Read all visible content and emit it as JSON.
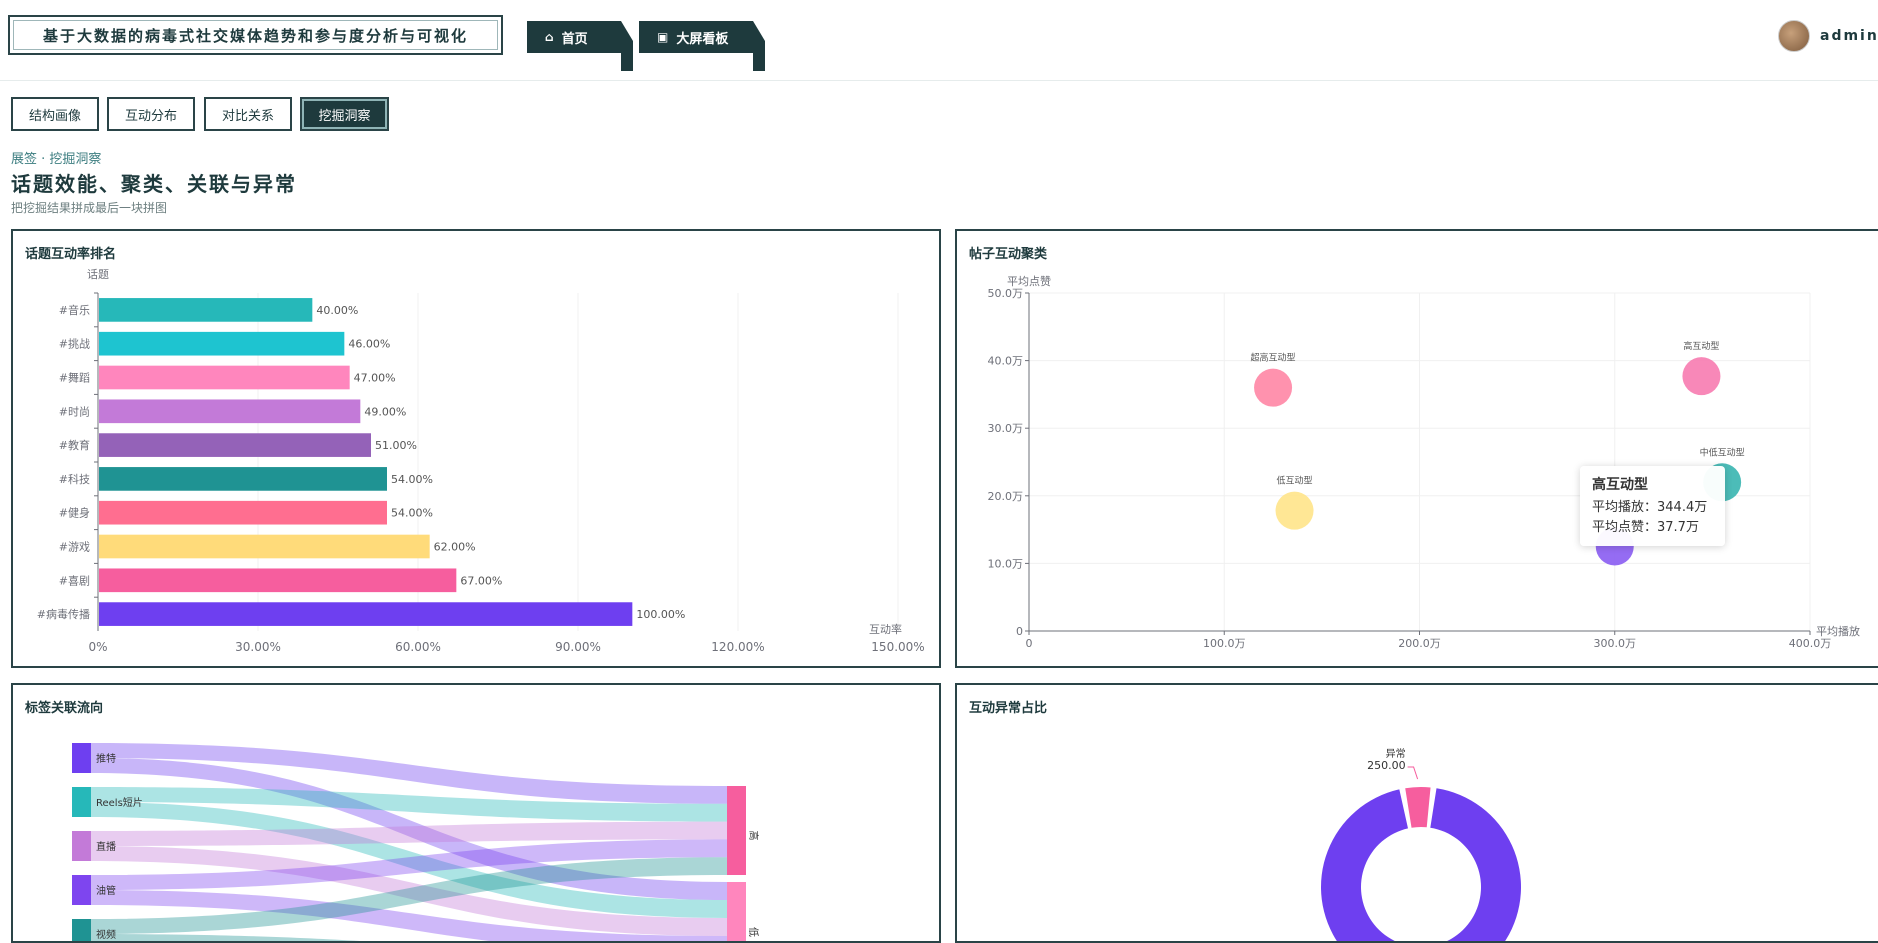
{
  "header": {
    "title": "基于大数据的病毒式社交媒体趋势和参与度分析与可视化",
    "nav": [
      {
        "label": "首页",
        "icon": "home-icon"
      },
      {
        "label": "大屏看板",
        "icon": "dashboard-icon"
      }
    ],
    "user": {
      "name": "admin"
    }
  },
  "subtabs": [
    {
      "label": "结构画像",
      "active": false
    },
    {
      "label": "互动分布",
      "active": false
    },
    {
      "label": "对比关系",
      "active": false
    },
    {
      "label": "挖掘洞察",
      "active": true
    }
  ],
  "page": {
    "breadcrumb": "展签 · 挖掘洞察",
    "title": "话题效能、聚类、关联与异常",
    "subtitle": "把挖掘结果拼成最后一块拼图"
  },
  "panels": {
    "bar": {
      "title": "话题互动率排名"
    },
    "scatter": {
      "title": "帖子互动聚类"
    },
    "sankey": {
      "title": "标签关联流向"
    },
    "pie": {
      "title": "互动异常占比"
    }
  },
  "tooltip": {
    "title": "高互动型",
    "play_label": "平均播放：344.4万",
    "like_label": "平均点赞：37.7万"
  },
  "colors": {
    "primary": "#1e3a3d",
    "accent": "#6e3ff0"
  },
  "chart_data": [
    {
      "type": "bar",
      "title": "话题互动率排名",
      "ylabel": "话题",
      "xlabel": "互动率",
      "orientation": "horizontal",
      "xlim": [
        0,
        150
      ],
      "xticks": [
        "0%",
        "30.00%",
        "60.00%",
        "90.00%",
        "120.00%",
        "150.00%"
      ],
      "categories": [
        "#音乐",
        "#挑战",
        "#舞蹈",
        "#时尚",
        "#教育",
        "#科技",
        "#健身",
        "#游戏",
        "#喜剧",
        "#病毒传播"
      ],
      "values": [
        40,
        46,
        47,
        49,
        51,
        54,
        54,
        62,
        67,
        100
      ],
      "value_labels": [
        "40.00%",
        "46.00%",
        "47.00%",
        "49.00%",
        "51.00%",
        "54.00%",
        "54.00%",
        "62.00%",
        "67.00%",
        "100.00%"
      ],
      "bar_colors": [
        "#26b8b9",
        "#1ec4d0",
        "#ff86bd",
        "#c37ad8",
        "#9462b8",
        "#1f9393",
        "#ff6e90",
        "#ffdb7a",
        "#f65e9e",
        "#6e3ff0"
      ]
    },
    {
      "type": "scatter",
      "title": "帖子互动聚类",
      "xlabel": "平均播放",
      "ylabel": "平均点赞",
      "xlim": [
        0,
        400
      ],
      "ylim": [
        0,
        50
      ],
      "xticks": [
        "0",
        "100.0万",
        "200.0万",
        "300.0万",
        "400.0万"
      ],
      "yticks": [
        "0",
        "10.0万",
        "20.0万",
        "30.0万",
        "40.0万",
        "50.0万"
      ],
      "points": [
        {
          "name": "超高互动型",
          "x": 125,
          "y": 36,
          "color": "#ff86a5"
        },
        {
          "name": "低互动型",
          "x": 136,
          "y": 17.8,
          "color": "#ffe48a"
        },
        {
          "name": "高互动型",
          "x": 344.4,
          "y": 37.7,
          "color": "#f77bb0"
        },
        {
          "name": "中低互动型",
          "x": 355,
          "y": 22,
          "color": "#38b5b0"
        },
        {
          "name": "",
          "x": 300,
          "y": 12.5,
          "color": "#8a5cf2"
        }
      ]
    },
    {
      "type": "sankey",
      "title": "标签关联流向",
      "sources": [
        {
          "name": "推特",
          "color": "#6e3ff0"
        },
        {
          "name": "Reels短片",
          "color": "#26b8b9"
        },
        {
          "name": "直播",
          "color": "#c37ad8"
        },
        {
          "name": "油管",
          "color": "#7e45ef"
        },
        {
          "name": "视频",
          "color": "#1f9393"
        }
      ],
      "targets": [
        {
          "name": "高",
          "color": "#f65e9e"
        },
        {
          "name": "低",
          "color": "#ff86bd"
        }
      ]
    },
    {
      "type": "pie",
      "title": "互动异常占比",
      "slices": [
        {
          "name": "异常",
          "value": 250.0,
          "label": "250.00",
          "color": "#f65e9e"
        },
        {
          "name": "",
          "value": 4750,
          "color": "#6e3ff0"
        }
      ]
    }
  ]
}
